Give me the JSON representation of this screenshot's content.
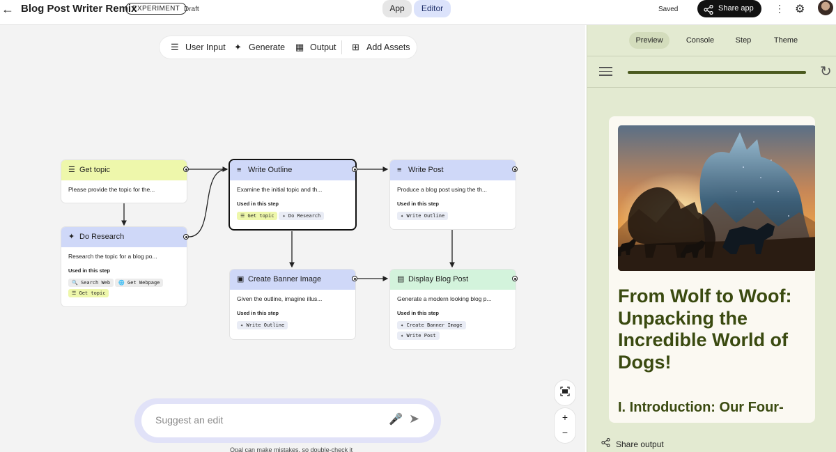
{
  "header": {
    "back_icon": "arrow-left-icon",
    "title": "Blog Post Writer Remix",
    "badge": "EXPERIMENT",
    "status": "Draft",
    "tabs": [
      "App",
      "Editor"
    ],
    "active_tab": "Editor",
    "saved": "Saved",
    "share_label": "Share app"
  },
  "toolbar": {
    "user_input": "User Input",
    "generate": "Generate",
    "output": "Output",
    "add_assets": "Add Assets"
  },
  "nodes": {
    "get_topic": {
      "title": "Get topic",
      "desc": "Please provide the topic for the..."
    },
    "do_research": {
      "title": "Do Research",
      "desc": "Research the topic for a blog po...",
      "used_label": "Used in this step",
      "chips": [
        "Search Web",
        "Get Webpage",
        "Get topic"
      ]
    },
    "write_outline": {
      "title": "Write Outline",
      "desc": "Examine the initial topic and th...",
      "used_label": "Used in this step",
      "chips": [
        "Get topic",
        "Do Research"
      ]
    },
    "write_post": {
      "title": "Write Post",
      "desc": "Produce a blog post using the th...",
      "used_label": "Used in this step",
      "chips": [
        "Write Outline"
      ]
    },
    "create_banner": {
      "title": "Create Banner Image",
      "desc": "Given the outline, imagine illus...",
      "used_label": "Used in this step",
      "chips": [
        "Write Outline"
      ]
    },
    "display_blog": {
      "title": "Display Blog Post",
      "desc": "Generate a modern looking blog p...",
      "used_label": "Used in this step",
      "chips": [
        "Create Banner Image",
        "Write Post"
      ]
    }
  },
  "suggest": {
    "placeholder": "Suggest an edit",
    "disclaimer": "Opal can make mistakes, so double-check it"
  },
  "preview": {
    "tabs": [
      "Preview",
      "Console",
      "Step",
      "Theme"
    ],
    "active_tab": "Preview",
    "progress": 1.0,
    "blog_title": "From Wolf to Woof: Unpacking the Incredible World of Dogs!",
    "section_heading": "I. Introduction: Our Four-",
    "share_output": "Share output"
  },
  "colors": {
    "accent_blue": "#cfd8f8",
    "accent_yellow": "#eef7ab",
    "accent_green": "#d3f3dc",
    "preview_bg": "#e3ead1",
    "title_olive": "#3a4a10"
  }
}
